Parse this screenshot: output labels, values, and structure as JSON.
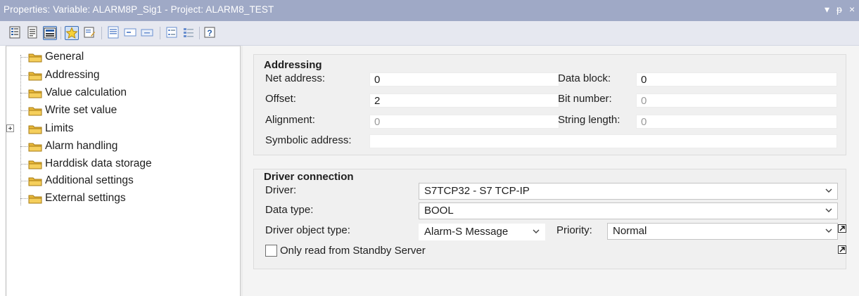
{
  "window": {
    "title": "Properties: Variable: ALARM8P_Sig1 - Project: ALARM8_TEST",
    "controls": {
      "menu": "▾",
      "pin": "ᵽ",
      "close": "×"
    }
  },
  "toolbar": {
    "buttons": [
      {
        "icon": "properties-grid-icon"
      },
      {
        "icon": "document-icon"
      },
      {
        "icon": "form-view-icon"
      },
      {
        "icon": "favorites-star-icon"
      },
      {
        "icon": "edit-properties-icon"
      },
      {
        "icon": "details-icon"
      },
      {
        "icon": "textbox-icon"
      },
      {
        "icon": "button-icon"
      },
      {
        "icon": "expand-all-icon"
      },
      {
        "icon": "collapse-all-icon"
      },
      {
        "icon": "help-icon"
      }
    ]
  },
  "tree": {
    "items": [
      {
        "label": "General"
      },
      {
        "label": "Addressing"
      },
      {
        "label": "Value calculation"
      },
      {
        "label": "Write set value"
      },
      {
        "label": "Limits"
      },
      {
        "label": "Alarm handling"
      },
      {
        "label": "Harddisk data storage"
      },
      {
        "label": "Additional settings"
      },
      {
        "label": "External settings"
      }
    ]
  },
  "addressing": {
    "title": "Addressing",
    "net_address_label": "Net address:",
    "net_address_value": "0",
    "offset_label": "Offset:",
    "offset_value": "2",
    "alignment_label": "Alignment:",
    "alignment_value": "0",
    "symbolic_label": "Symbolic address:",
    "symbolic_value": "",
    "data_block_label": "Data block:",
    "data_block_value": "0",
    "bit_number_label": "Bit number:",
    "bit_number_value": "0",
    "string_length_label": "String length:",
    "string_length_value": "0"
  },
  "driver_connection": {
    "title": "Driver connection",
    "driver_label": "Driver:",
    "driver_value": "S7TCP32 - S7 TCP-IP",
    "data_type_label": "Data type:",
    "data_type_value": "BOOL",
    "object_type_label": "Driver object type:",
    "object_type_value": "Alarm-S Message",
    "priority_label": "Priority:",
    "priority_value": "Normal",
    "standby_label": "Only read from Standby Server",
    "standby_checked": false
  },
  "colors": {
    "titlebar": "#9fa9c6",
    "toolbar": "#e6e8f0",
    "folder": "#e8b83a",
    "accent": "#3d6fb6"
  }
}
